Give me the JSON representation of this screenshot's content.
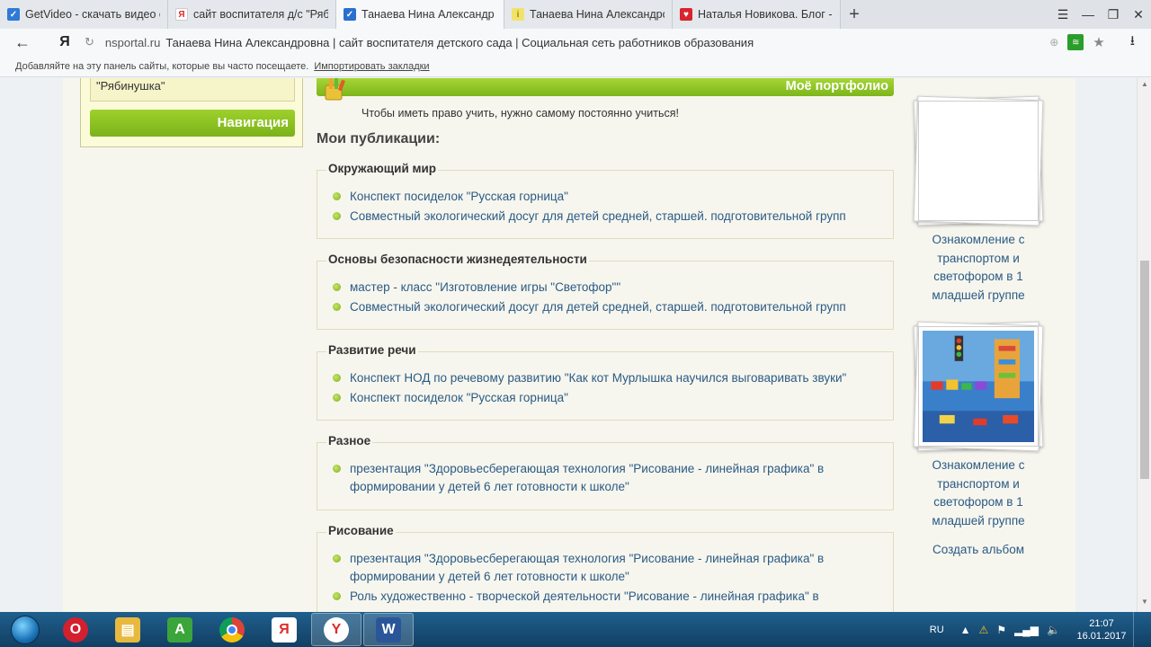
{
  "browser": {
    "tabs": [
      {
        "label": "GetVideo - скачать видео с",
        "favicon": "getvideo-icon",
        "color": "#2f7ad6"
      },
      {
        "label": "сайт воспитателя д/с \"Рябин",
        "favicon": "yandex-icon",
        "color": "#ffffff"
      },
      {
        "label": "Танаева Нина Александр",
        "favicon": "check-icon",
        "color": "#2a6fcf",
        "active": true
      },
      {
        "label": "Танаева Нина Александров",
        "favicon": "nsportal-icon",
        "color": "#f2e26a"
      },
      {
        "label": "Наталья Новикова. Блог - С",
        "favicon": "heart-icon",
        "color": "#d9232e"
      }
    ],
    "new_tab": "+",
    "window_controls": {
      "menu": "☰",
      "minimize": "—",
      "restore": "❐",
      "close": "✕"
    },
    "back": "←",
    "logo": "Я",
    "url_domain": "nsportal.ru",
    "url_title": "Танаева Нина Александровна | сайт воспитателя детского сада | Социальная сеть работников образования",
    "bookmarks_text": "Добавляйте на эту панель сайты, которые вы часто посещаете.",
    "bookmarks_link": "Импортировать закладки"
  },
  "page": {
    "sidebar_text": "\"Рябинушка\"",
    "nav_button": "Навигация",
    "portfolio_banner": "Моё портфолио",
    "motto": "Чтобы иметь право учить, нужно самому постоянно учиться!",
    "publications_title": "Мои публикации:",
    "categories": [
      {
        "title": "Окружающий мир",
        "items": [
          "Конспект посиделок \"Русская горница\"",
          "Совместный экологический досуг для детей средней, старшей. подготовительной групп"
        ]
      },
      {
        "title": "Основы безопасности жизнедеятельности",
        "items": [
          "мастер - класс \"Изготовление игры \"Светофор\"\"",
          "Совместный экологический досуг для детей средней, старшей. подготовительной групп"
        ]
      },
      {
        "title": "Развитие речи",
        "items": [
          "Конспект НОД по речевому развитию \"Как кот Мурлышка научился выговаривать звуки\"",
          "Конспект посиделок \"Русская горница\""
        ]
      },
      {
        "title": "Разное",
        "items": [
          "презентация \"Здоровьесберегающая технология \"Рисование - линейная графика\" в формировании у детей 6 лет готовности к школе\""
        ]
      },
      {
        "title": "Рисование",
        "items": [
          "презентация \"Здоровьесберегающая технология \"Рисование - линейная графика\" в формировании у детей 6 лет готовности к школе\"",
          "Роль художественно - творческой деятельности \"Рисование - линейная графика\" в"
        ]
      }
    ],
    "albums": [
      {
        "caption": "Ознакомление с транспортом и светофором в 1 младшей группе",
        "has_photo": false
      },
      {
        "caption": "Ознакомление с транспортом и светофором в 1 младшей группе",
        "has_photo": true
      }
    ],
    "create_album": "Создать альбом"
  },
  "taskbar": {
    "apps": [
      {
        "name": "opera-icon",
        "color": "#d3202f",
        "glyph": "O"
      },
      {
        "name": "explorer-icon",
        "color": "#e8b93e",
        "glyph": "▤"
      },
      {
        "name": "a-app-icon",
        "color": "#3aa53a",
        "glyph": "A"
      },
      {
        "name": "chrome-icon",
        "color": "#e9a93a",
        "glyph": "◉"
      },
      {
        "name": "yandex-browser-icon",
        "color": "#e84a3c",
        "glyph": "Я"
      },
      {
        "name": "yandex-y-icon",
        "color": "#e02b2b",
        "glyph": "Y",
        "active": true
      },
      {
        "name": "word-icon",
        "color": "#2a5699",
        "glyph": "W",
        "active": true
      }
    ],
    "language": "RU",
    "time": "21:07",
    "date": "16.01.2017"
  }
}
